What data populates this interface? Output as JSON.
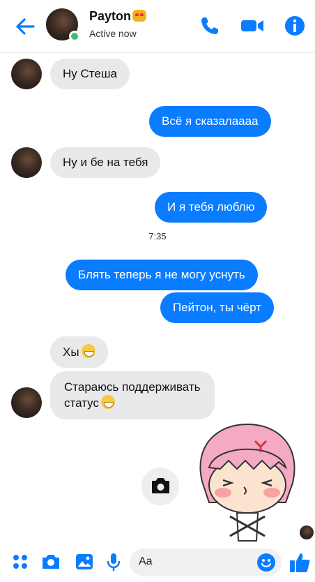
{
  "header": {
    "contact_name": "Payton",
    "status": "Active now"
  },
  "messages": [
    {
      "dir": "in",
      "text": "Ну Стеша"
    },
    {
      "dir": "out",
      "text": "Всё я сказалаааа"
    },
    {
      "dir": "in",
      "text": "Ну и бе на тебя"
    },
    {
      "dir": "out",
      "text": "И я тебя люблю"
    },
    {
      "dir": "out",
      "text": "Блять теперь я не могу уснуть"
    },
    {
      "dir": "out",
      "text": "Пейтон, ты чёрт"
    },
    {
      "dir": "in",
      "text": "Хы"
    },
    {
      "dir": "in",
      "text_line1": "Стараюсь поддерживать",
      "text_line2": "статус"
    }
  ],
  "timestamp": "7:35",
  "composer": {
    "placeholder": "Aa"
  },
  "colors": {
    "accent": "#0a7cff",
    "incoming_bubble": "#e9e9ec",
    "online": "#38c172"
  },
  "icons": [
    "back-arrow-icon",
    "phone-icon",
    "video-call-icon",
    "info-icon",
    "apps-icon",
    "camera-icon",
    "gallery-icon",
    "microphone-icon",
    "emoji-icon",
    "thumbs-up-icon"
  ]
}
